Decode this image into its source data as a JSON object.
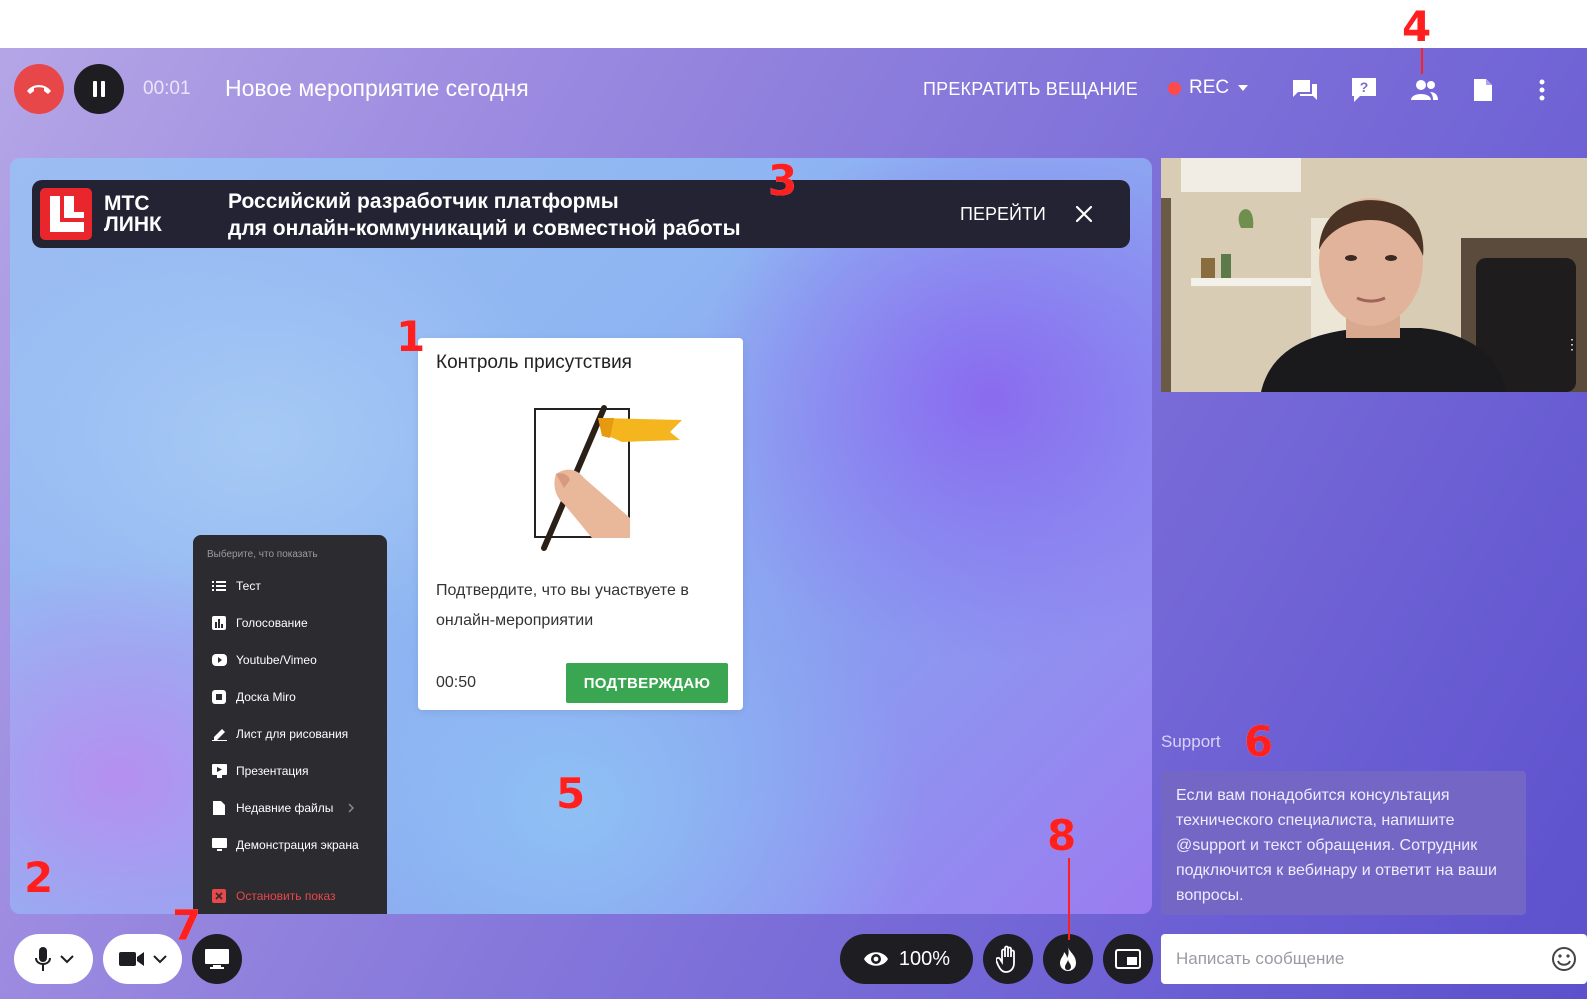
{
  "topbar": {
    "timer": "00:01",
    "event_title": "Новое мероприятие сегодня",
    "stop_broadcast": "ПРЕКРАТИТЬ ВЕЩАНИЕ",
    "rec_label": "REC",
    "icons": [
      "phone-hangup-icon",
      "pause-icon",
      "chat-icon",
      "question-icon",
      "participants-icon",
      "file-icon",
      "more-icon"
    ]
  },
  "banner": {
    "brand_line1": "МТС",
    "brand_line2": "ЛИНК",
    "text_line1": "Российский разработчик платформы",
    "text_line2": "для онлайн-коммуникаций и совместной работы",
    "link_label": "ПЕРЕЙТИ"
  },
  "attendance_card": {
    "title": "Контроль присутствия",
    "text": "Подтвердите, что вы участвуете в онлайн-мероприятии",
    "timer": "00:50",
    "confirm_label": "ПОДТВЕРЖДАЮ"
  },
  "show_menu": {
    "header": "Выберите, что показать",
    "items": [
      {
        "label": "Тест",
        "icon": "list-icon"
      },
      {
        "label": "Голосование",
        "icon": "poll-icon"
      },
      {
        "label": "Youtube/Vimeo",
        "icon": "play-icon"
      },
      {
        "label": "Доска Miro",
        "icon": "board-icon"
      },
      {
        "label": "Лист для рисования",
        "icon": "pencil-icon"
      },
      {
        "label": "Презентация",
        "icon": "presentation-icon"
      },
      {
        "label": "Недавние файлы",
        "icon": "file-icon"
      },
      {
        "label": "Демонстрация экрана",
        "icon": "monitor-icon"
      }
    ],
    "stop_label": "Остановить показ"
  },
  "chat": {
    "author": "Support",
    "message": "Если вам понадобится консультация технического специалиста, напишите @support и текст обращения. Сотрудник подключится к вебинару и ответит на ваши вопросы.",
    "input_placeholder": "Написать сообщение"
  },
  "controls": {
    "zoom": "100%"
  },
  "markers": [
    "1",
    "2",
    "3",
    "4",
    "5",
    "6",
    "7",
    "8"
  ],
  "colors": {
    "hangup": "#e8474a",
    "confirm": "#3aa652",
    "marker": "#ff1f1f",
    "banner_logo": "#e8262b"
  }
}
